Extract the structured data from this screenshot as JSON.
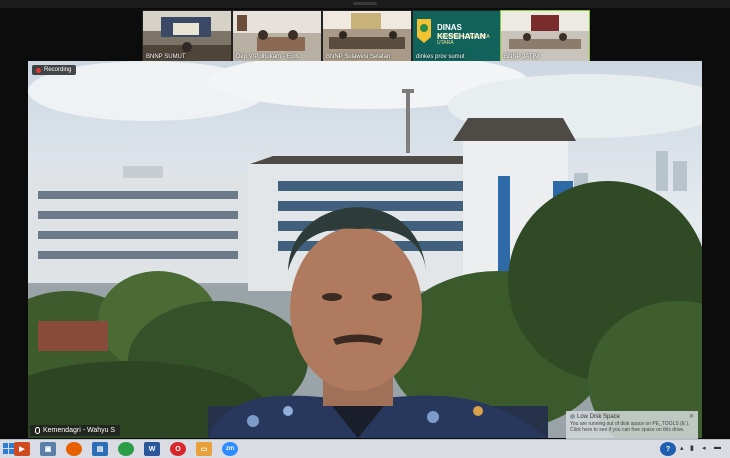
{
  "window": {
    "recording_label": "Recording"
  },
  "participants": [
    {
      "name": "BNNP SUMUT",
      "active": false
    },
    {
      "name": "Dep V/Polhukam - Eros",
      "active": false
    },
    {
      "name": "BNNP Sulawesi Selatan",
      "active": false
    },
    {
      "name": "dinkes prov sumut",
      "active": false,
      "banner_title": "DINAS KESEHATAN",
      "banner_subtitle": "PROVINSI SUMATERA UTARA"
    },
    {
      "name": "BNNP JATIM",
      "active": true
    }
  ],
  "speaker": {
    "name": "Kemendagri - Wahyu S"
  },
  "notification": {
    "title": "Low Disk Space",
    "line1": "You are running out of disk space on PE_TOOLS (E:).",
    "line2": "Click here to see if you can free space on this drive."
  },
  "taskbar": {
    "icons": [
      "start-icon",
      "powerpoint-icon",
      "windows-explorer-icon",
      "firefox-icon",
      "zoom-folder-icon",
      "chrome-icon",
      "word-icon",
      "opera-icon",
      "files-icon",
      "zoom-icon"
    ],
    "zoom_label": "zm"
  },
  "colors": {
    "active_border": "#8cc63f",
    "recording_dot": "#e53935",
    "taskbar_bg": "#d9dde3"
  }
}
